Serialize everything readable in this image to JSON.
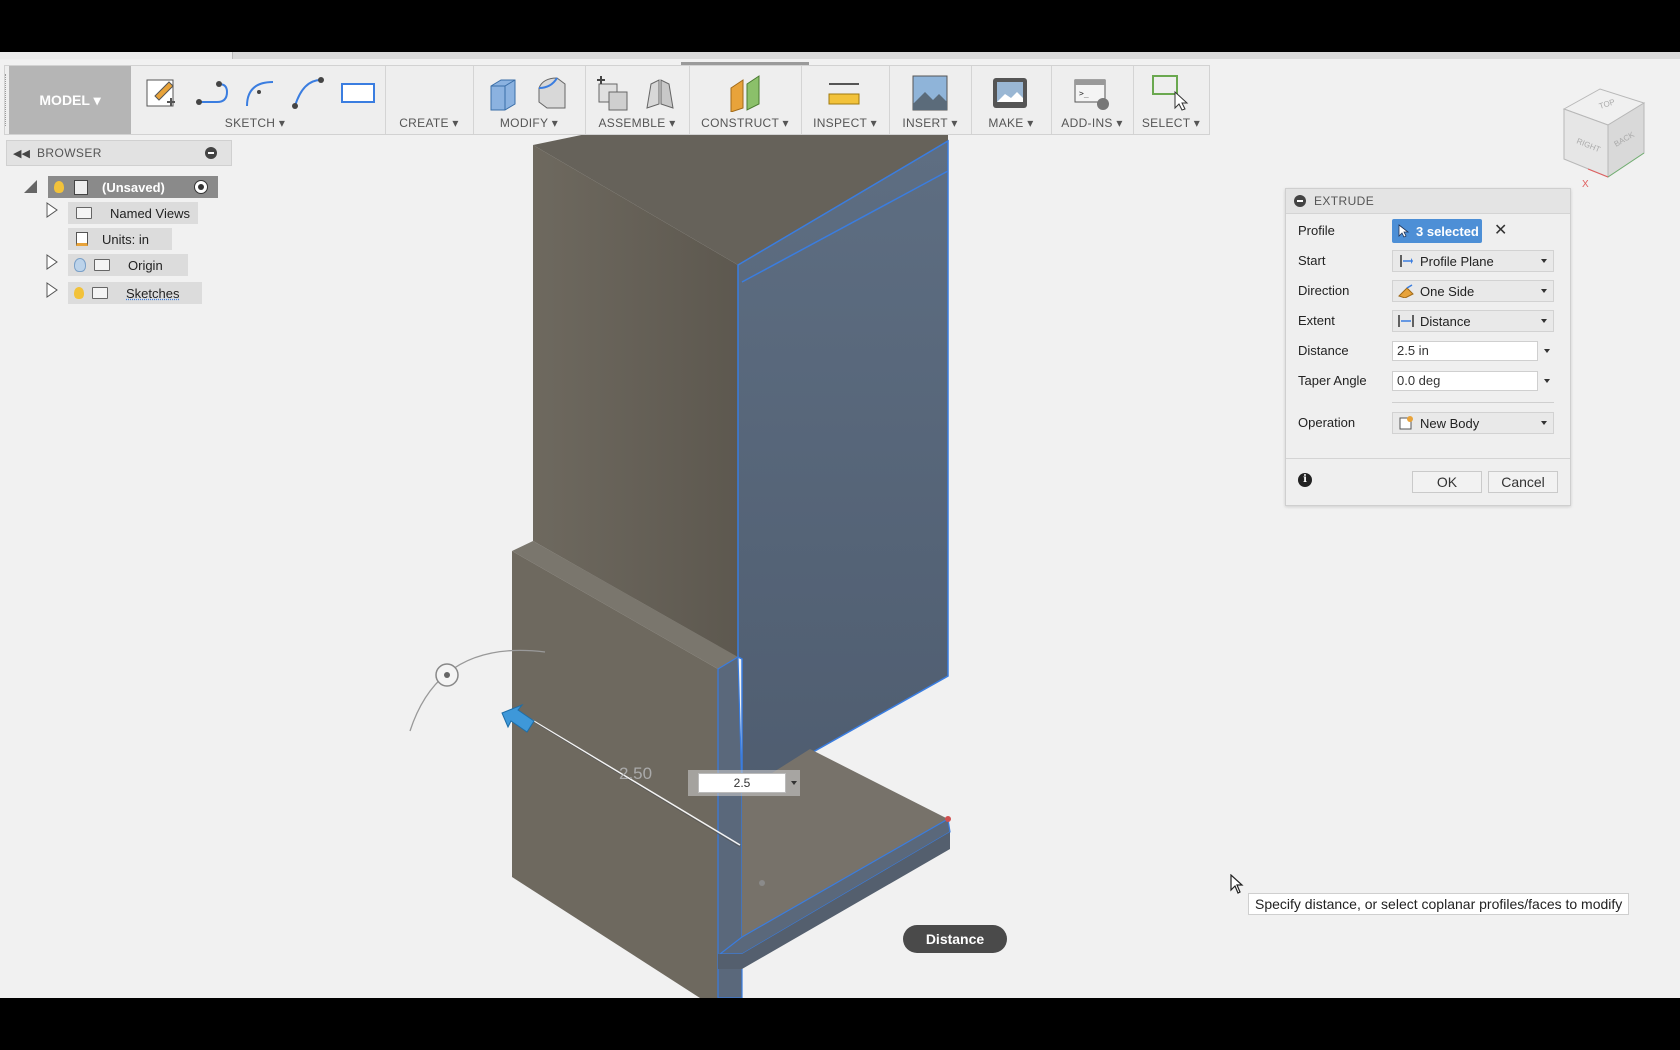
{
  "toolbar": {
    "mode_label": "MODEL ▾",
    "groups": [
      {
        "label": "SKETCH ▾"
      },
      {
        "label": "CREATE ▾"
      },
      {
        "label": "MODIFY ▾"
      },
      {
        "label": "ASSEMBLE ▾"
      },
      {
        "label": "CONSTRUCT ▾"
      },
      {
        "label": "INSPECT ▾"
      },
      {
        "label": "INSERT ▾"
      },
      {
        "label": "MAKE ▾"
      },
      {
        "label": "ADD-INS ▾"
      },
      {
        "label": "SELECT ▾"
      }
    ]
  },
  "browser": {
    "title": "BROWSER",
    "root": "(Unsaved)",
    "items": [
      {
        "label": "Named Views"
      },
      {
        "label": "Units: in"
      },
      {
        "label": "Origin"
      },
      {
        "label": "Sketches"
      }
    ]
  },
  "extrude": {
    "title": "EXTRUDE",
    "rows": {
      "profile": {
        "label": "Profile",
        "value": "3 selected"
      },
      "start": {
        "label": "Start",
        "value": "Profile Plane"
      },
      "direction": {
        "label": "Direction",
        "value": "One Side"
      },
      "extent": {
        "label": "Extent",
        "value": "Distance"
      },
      "distance": {
        "label": "Distance",
        "value": "2.5 in"
      },
      "taper": {
        "label": "Taper Angle",
        "value": "0.0 deg"
      },
      "operation": {
        "label": "Operation",
        "value": "New Body"
      }
    },
    "ok": "OK",
    "cancel": "Cancel"
  },
  "viewport": {
    "dimension_label": "2.50",
    "dimension_input": "2.5",
    "distance_pill": "Distance",
    "tooltip": "Specify distance, or select coplanar profiles/faces to modify"
  },
  "viewcube": {
    "faces": [
      "TOP",
      "RIGHT",
      "BACK"
    ]
  },
  "colors": {
    "accent": "#4d8fd6",
    "body": "#6f6a62",
    "selected_face": "#566579",
    "edge_highlight": "#3a7de0"
  }
}
